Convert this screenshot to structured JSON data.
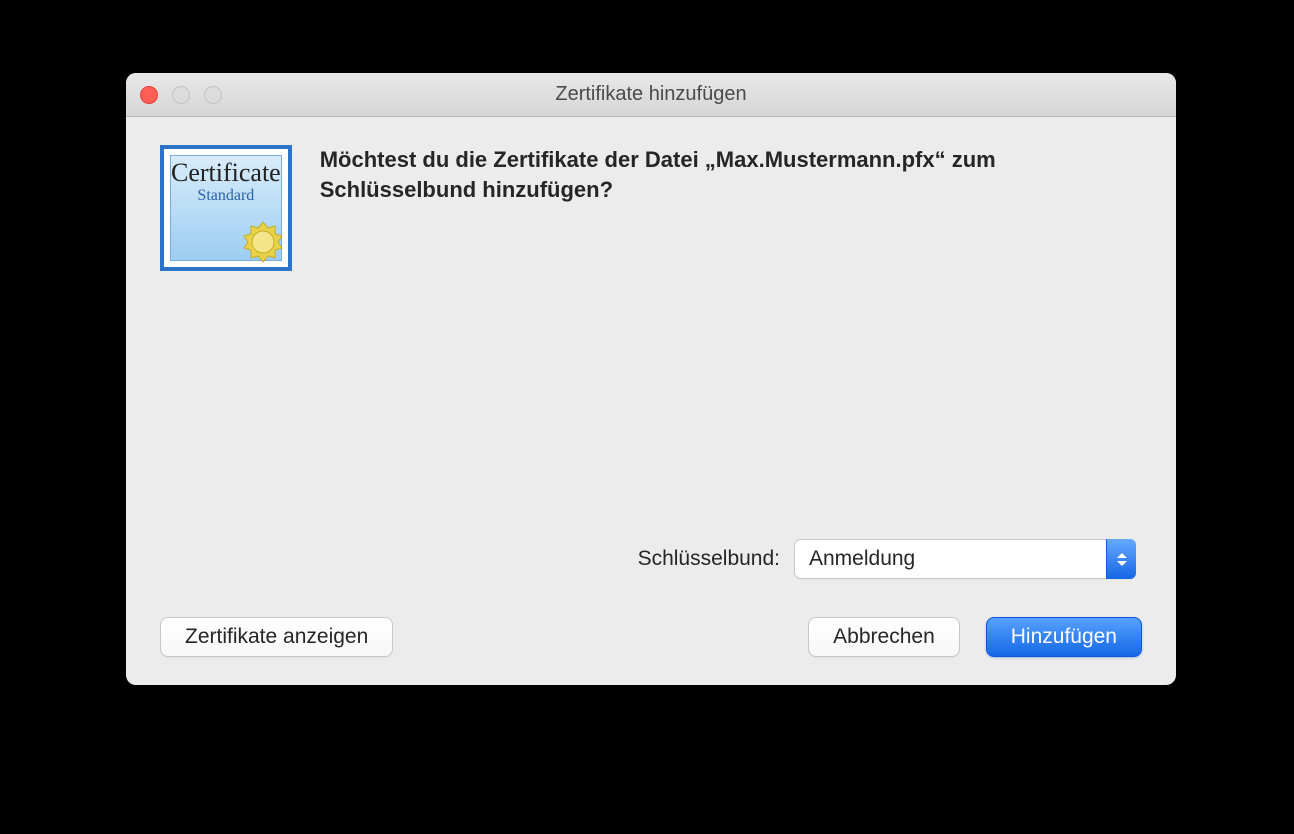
{
  "window": {
    "title": "Zertifikate hinzufügen"
  },
  "icon": {
    "line1": "Certificate",
    "line2": "Standard"
  },
  "message": "Möchtest du die Zertifikate der Datei „Max.Mustermann.pfx“ zum Schlüsselbund hinzufügen?",
  "keychain": {
    "label": "Schlüsselbund:",
    "selected": "Anmeldung"
  },
  "buttons": {
    "show_certificates": "Zertifikate anzeigen",
    "cancel": "Abbrechen",
    "add": "Hinzufügen"
  }
}
